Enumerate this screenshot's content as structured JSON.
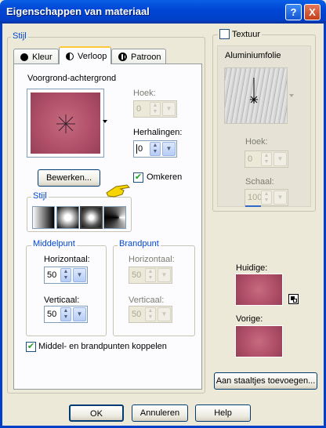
{
  "window": {
    "title": "Eigenschappen van materiaal",
    "help_glyph": "?",
    "close_glyph": "X"
  },
  "left_group": {
    "label": "Stijl"
  },
  "tabs": [
    {
      "label": "Kleur",
      "icon": "circle-fill-icon"
    },
    {
      "label": "Verloop",
      "icon": "half-circle-icon"
    },
    {
      "label": "Patroon",
      "icon": "pattern-icon"
    }
  ],
  "gradient": {
    "name_label": "Voorgrond-achtergrond",
    "angle_label": "Hoek:",
    "angle_value": "0",
    "repeats_label": "Herhalingen:",
    "repeats_value": "0",
    "edit_button": "Bewerken...",
    "invert_label": "Omkeren",
    "invert_checked": true,
    "style_group_label": "Stijl",
    "styles": [
      "linear",
      "rectangular",
      "sunburst",
      "radial"
    ],
    "selected_style": "sunburst",
    "colors": {
      "swatch": "#b25069",
      "accent": "#0046d5"
    }
  },
  "center_point": {
    "label": "Middelpunt",
    "h_label": "Horizontaal:",
    "h_value": "50",
    "v_label": "Verticaal:",
    "v_value": "50"
  },
  "focal_point": {
    "label": "Brandpunt",
    "h_label": "Horizontaal:",
    "h_value": "50",
    "v_label": "Verticaal:",
    "v_value": "50"
  },
  "link_points": {
    "label": "Middel- en brandpunten koppelen",
    "checked": true
  },
  "texture": {
    "label": "Textuur",
    "checked": false,
    "name": "Aluminiumfolie",
    "angle_label": "Hoek:",
    "angle_value": "0",
    "scale_label": "Schaal:",
    "scale_value": "100"
  },
  "preview": {
    "current_label": "Huidige:",
    "previous_label": "Vorige:"
  },
  "swatch_button": "Aan staaltjes toevoegen...",
  "footer": {
    "ok": "OK",
    "cancel": "Annuleren",
    "help": "Help"
  }
}
